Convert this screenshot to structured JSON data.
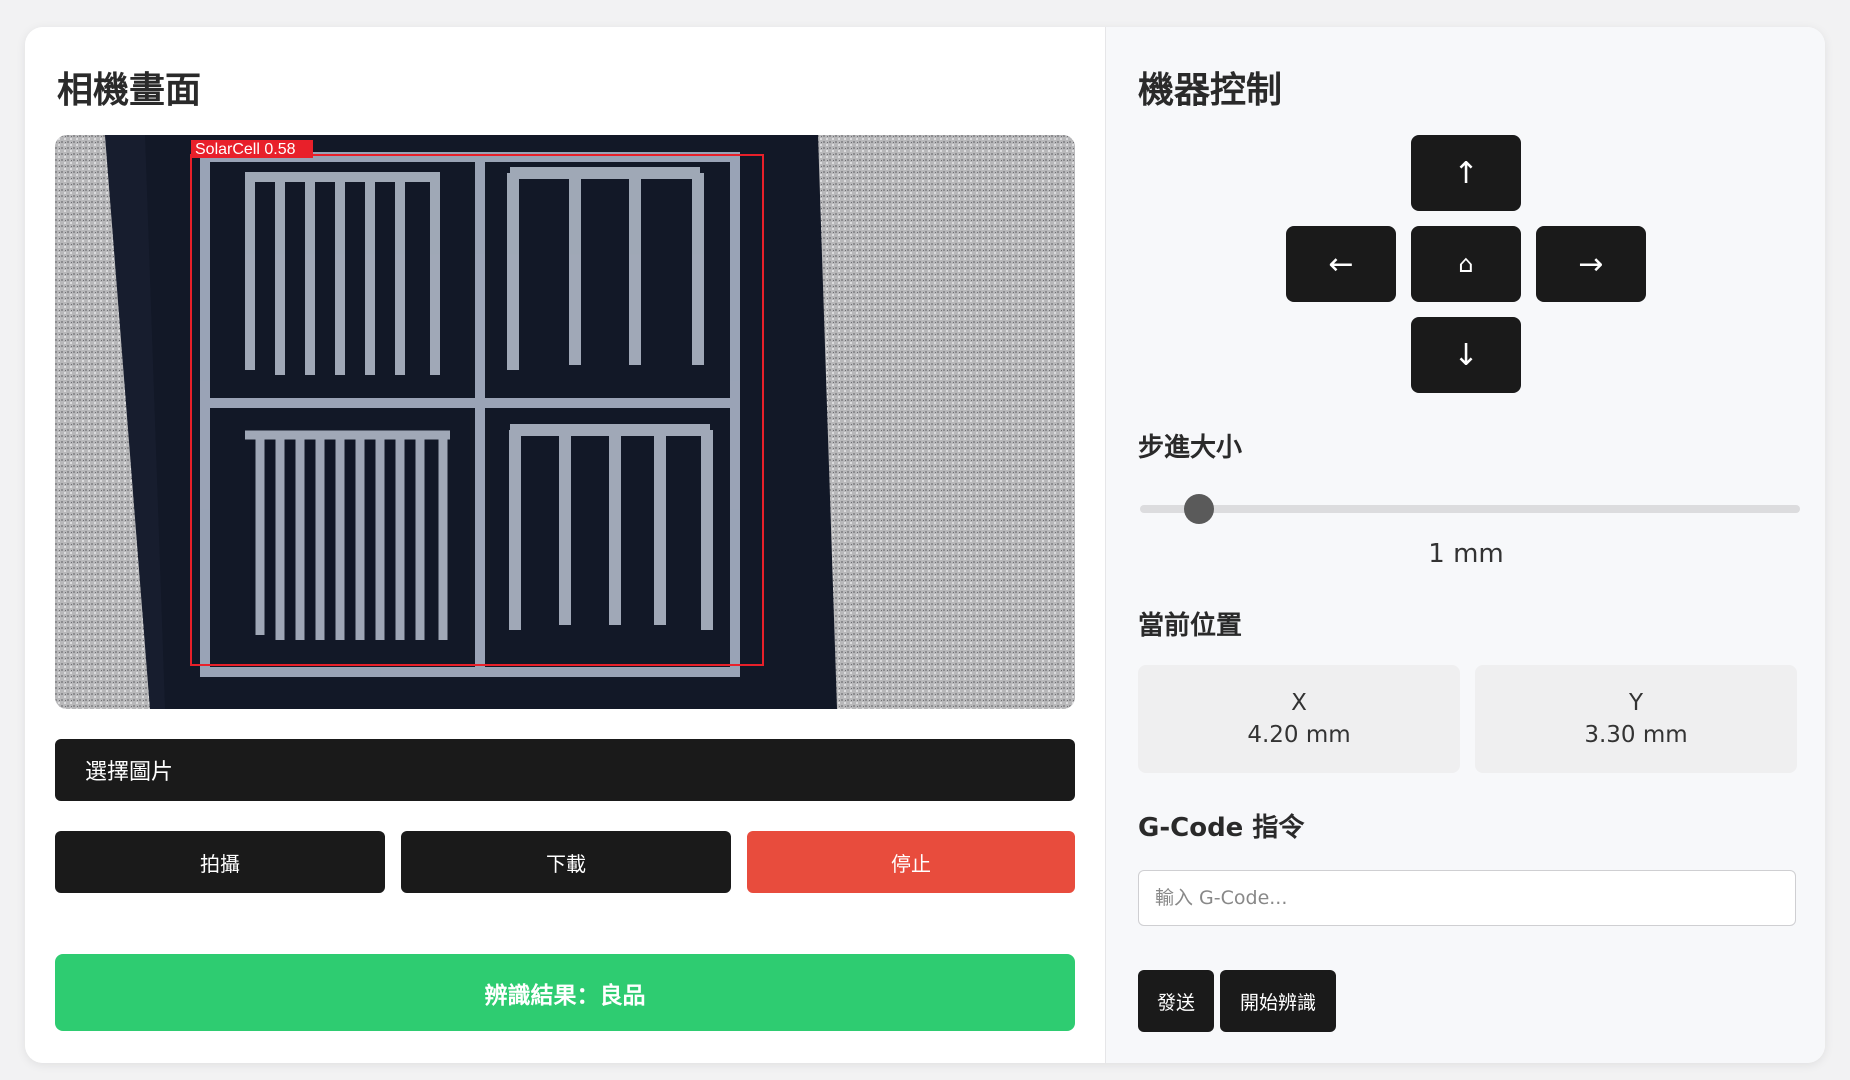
{
  "camera": {
    "title": "相機畫面",
    "detection_label": "SolarCell  0.58",
    "select_image_label": "選擇圖片",
    "capture_label": "拍攝",
    "download_label": "下載",
    "stop_label": "停止",
    "result_text": "辨識結果：良品",
    "colors": {
      "stop": "#e84c3d",
      "result": "#2ecc71",
      "detection_box": "#e8202a"
    }
  },
  "control": {
    "title": "機器控制",
    "dpad": {
      "up": "↑",
      "left": "←",
      "home": "⌂",
      "right": "→",
      "down": "↓"
    },
    "step_label": "步進大小",
    "step_value_text": "1 mm",
    "step_fraction": 0.09,
    "position_label": "當前位置",
    "x": {
      "axis": "X",
      "value": "4.20 mm"
    },
    "y": {
      "axis": "Y",
      "value": "3.30 mm"
    },
    "gcode_label": "G-Code 指令",
    "gcode_placeholder": "輸入 G-Code...",
    "send_label": "發送",
    "start_recognition_label": "開始辨識"
  }
}
